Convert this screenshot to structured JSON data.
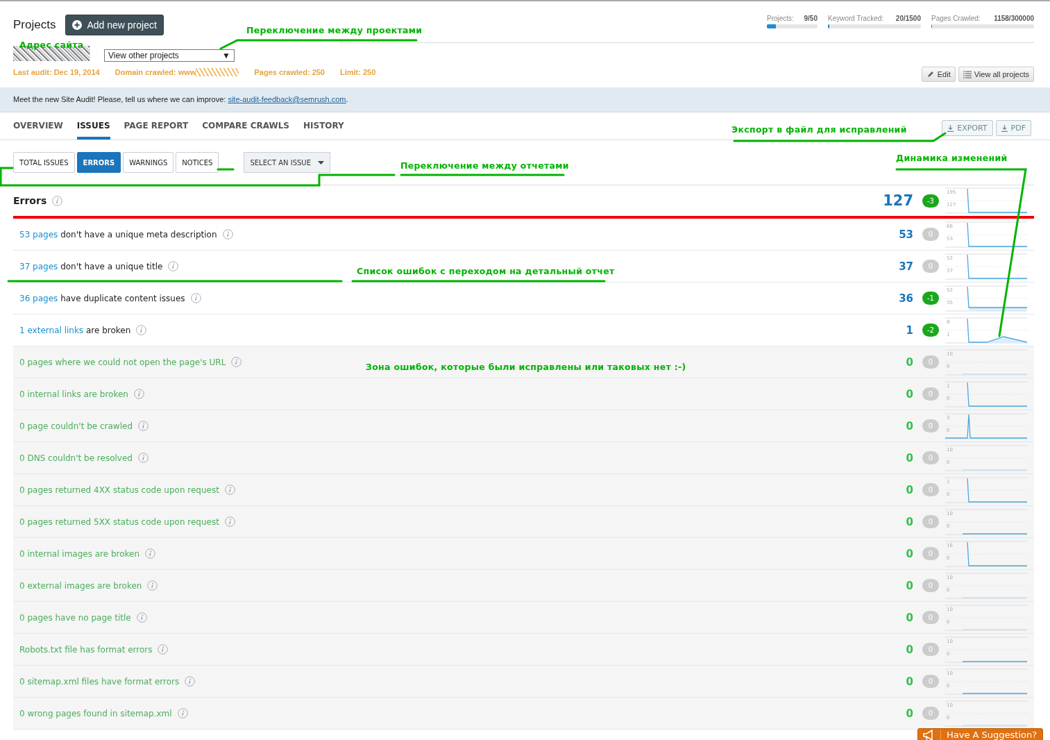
{
  "header": {
    "title": "Projects",
    "add_button": "Add new project",
    "project_select": "View other projects",
    "project_select_caret": "▼",
    "audit_info": [
      {
        "text": "Last audit: Dec 19, 2014",
        "obscured": false
      },
      {
        "text": "Domain crawled: www",
        "obscured": true
      },
      {
        "text": "Pages crawled: 250",
        "obscured": false
      },
      {
        "text": "Limit: 250",
        "obscured": false
      }
    ],
    "limits": [
      {
        "label": "Projects:",
        "value": "9/50",
        "level": 0.18
      },
      {
        "label": "Keyword Tracked:",
        "value": "20/1500",
        "level": 0.013
      },
      {
        "label": "Pages Crawled:",
        "value": "1158/300000",
        "level": 0.004
      }
    ],
    "buttons": [
      {
        "label": "Edit",
        "kind": "edit"
      },
      {
        "label": "View all projects",
        "kind": "list"
      }
    ]
  },
  "banner": {
    "text": "Meet the new Site Audit! Please, tell us where we can improve: ",
    "link": "site-audit-feedback@semrush.com",
    "after": "."
  },
  "nav_tabs": [
    {
      "label": "OVERVIEW",
      "selected": false
    },
    {
      "label": "ISSUES",
      "selected": true
    },
    {
      "label": "PAGE REPORT",
      "selected": false
    },
    {
      "label": "COMPARE CRAWLS",
      "selected": false
    },
    {
      "label": "HISTORY",
      "selected": false
    }
  ],
  "export_buttons": [
    "EXPORT",
    "PDF"
  ],
  "filter_tabs": [
    {
      "label": "TOTAL ISSUES",
      "selected": false
    },
    {
      "label": "ERRORS",
      "selected": true
    },
    {
      "label": "WARNINGS",
      "selected": false
    },
    {
      "label": "NOTICES",
      "selected": false
    }
  ],
  "issue_select": "SELECT AN ISSUE",
  "errors": {
    "title": "Errors",
    "count": "127",
    "delta": "-3",
    "improved": true,
    "spark": {
      "max": "195",
      "min": "127",
      "kind": "drop"
    }
  },
  "rows": [
    {
      "link": "53 pages",
      "text": " don't have a unique meta description",
      "fixed": false,
      "count": "53",
      "delta": "0",
      "improved": false,
      "spark": {
        "max": "66",
        "min": "53",
        "kind": "drop"
      }
    },
    {
      "link": "37 pages",
      "text": " don't have a unique title",
      "fixed": false,
      "count": "37",
      "delta": "0",
      "improved": false,
      "spark": {
        "max": "52",
        "min": "37",
        "kind": "drop"
      }
    },
    {
      "link": "36 pages",
      "text": " have duplicate content issues",
      "fixed": false,
      "count": "36",
      "delta": "-1",
      "improved": true,
      "spark": {
        "max": "52",
        "min": "35",
        "kind": "drop-fill"
      }
    },
    {
      "link": "1 external links",
      "text": " are broken",
      "fixed": false,
      "count": "1",
      "delta": "-2",
      "improved": true,
      "spark": {
        "max": "8",
        "min": "1",
        "kind": "drop-bump"
      }
    },
    {
      "text": "0 pages where we could not open the page's URL",
      "fixed": true,
      "count": "0",
      "delta": "0",
      "improved": false,
      "spark": {
        "max": "10",
        "min": "0",
        "kind": "flat-faint"
      }
    },
    {
      "text": "0 internal links are broken",
      "fixed": true,
      "count": "0",
      "delta": "0",
      "improved": false,
      "spark": {
        "max": "1",
        "min": "0",
        "kind": "drop"
      }
    },
    {
      "text": "0 page couldn't be crawled",
      "fixed": true,
      "count": "0",
      "delta": "0",
      "improved": false,
      "spark": {
        "max": "3",
        "min": "0",
        "kind": "spike"
      }
    },
    {
      "text": "0 DNS couldn't be resolved",
      "fixed": true,
      "count": "0",
      "delta": "0",
      "improved": false,
      "spark": {
        "max": "10",
        "min": "0",
        "kind": "flat-faint"
      }
    },
    {
      "text": "0 pages returned 4XX status code upon request",
      "fixed": true,
      "count": "0",
      "delta": "0",
      "improved": false,
      "spark": {
        "max": "1",
        "min": "0",
        "kind": "drop"
      }
    },
    {
      "text": "0 pages returned 5XX status code upon request",
      "fixed": true,
      "count": "0",
      "delta": "0",
      "improved": false,
      "spark": {
        "max": "10",
        "min": "0",
        "kind": "flat"
      }
    },
    {
      "text": "0 internal images are broken",
      "fixed": true,
      "count": "0",
      "delta": "0",
      "improved": false,
      "spark": {
        "max": "16",
        "min": "0",
        "kind": "drop"
      }
    },
    {
      "text": "0 external images are broken",
      "fixed": true,
      "count": "0",
      "delta": "0",
      "improved": false,
      "spark": {
        "max": "10",
        "min": "0",
        "kind": "flat-faint"
      }
    },
    {
      "text": "0 pages have no page title",
      "fixed": true,
      "count": "0",
      "delta": "0",
      "improved": false,
      "spark": {
        "max": "10",
        "min": "0",
        "kind": "flat-faint"
      }
    },
    {
      "text": "Robots.txt file has format errors",
      "fixed": true,
      "count": "0",
      "delta": "0",
      "improved": false,
      "spark": {
        "max": "10",
        "min": "0",
        "kind": "flat"
      }
    },
    {
      "text": "0 sitemap.xml files have format errors",
      "fixed": true,
      "count": "0",
      "delta": "0",
      "improved": false,
      "spark": {
        "max": "10",
        "min": "0",
        "kind": "flat"
      }
    },
    {
      "text": "0 wrong pages found in sitemap.xml",
      "fixed": true,
      "count": "0",
      "delta": "0",
      "improved": false,
      "spark": {
        "max": "10",
        "min": "0",
        "kind": "flat-faint"
      }
    }
  ],
  "suggestion_button": "Have A Suggestion?",
  "annotations": [
    "Адрес сайта",
    "Переключение между проектами",
    "Экспорт в файл для исправлений",
    "Переключение между отчетами",
    "Динамика изменений",
    "Список ошибок с переходом на детальный отчет",
    "Зона ошибок, которые были исправлены или таковых нет :-)"
  ]
}
